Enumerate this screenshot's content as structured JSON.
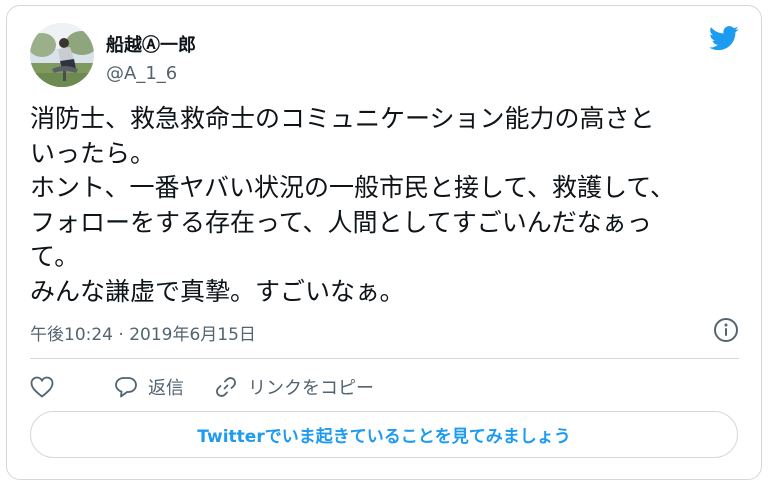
{
  "user": {
    "display_name": "船越Ⓐ一郎",
    "handle": "@A_1_6"
  },
  "tweet": {
    "text": "消防士、救急救命士のコミュニケーション能力の高さと\nいったら。\nホント、一番ヤバい状況の一般市民と接して、救護して、\nフォローをする存在って、人間としてすごいんだなぁっ\nて。\nみんな謙虚で真摯。すごいなぁ。",
    "timestamp": "午後10:24 · 2019年6月15日"
  },
  "actions": {
    "reply_label": "返信",
    "copy_link_label": "リンクをコピー"
  },
  "cta": {
    "label": "Twitterでいま起きていることを見てみましょう"
  },
  "icons": {
    "brand": "twitter-bird-icon",
    "info": "info-icon",
    "like": "heart-icon",
    "reply": "speech-bubble-icon",
    "link": "link-icon"
  },
  "colors": {
    "accent": "#1d9bf0",
    "secondary_text": "#536471",
    "border": "#cfd9de"
  }
}
